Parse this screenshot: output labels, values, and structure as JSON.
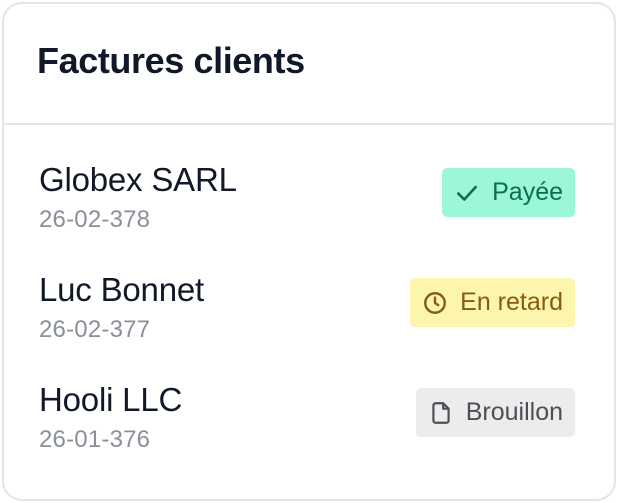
{
  "card": {
    "title": "Factures clients"
  },
  "invoices": [
    {
      "client": "Globex SARL",
      "number": "26-02-378",
      "status": "Payée",
      "status_kind": "paid",
      "icon": "check-icon"
    },
    {
      "client": "Luc Bonnet",
      "number": "26-02-377",
      "status": "En retard",
      "status_kind": "late",
      "icon": "clock-icon"
    },
    {
      "client": "Hooli LLC",
      "number": "26-01-376",
      "status": "Brouillon",
      "status_kind": "draft",
      "icon": "document-icon"
    }
  ],
  "colors": {
    "paid_bg": "#9cf7d6",
    "paid_text": "#0b6e4f",
    "late_bg": "#fbf5ad",
    "late_text": "#8a5a12",
    "draft_bg": "#ececec",
    "draft_text": "#4b4f56",
    "border": "#e3e5e8"
  }
}
